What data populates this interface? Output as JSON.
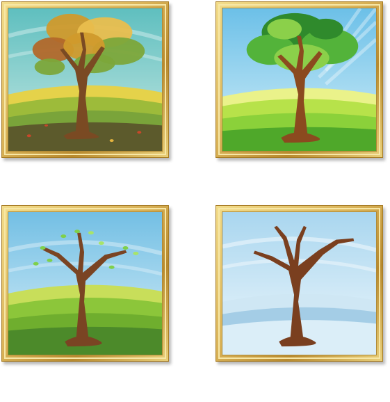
{
  "gallery": {
    "paintings": [
      {
        "season": "autumn",
        "sky": [
          "#5fbfbf",
          "#bfe6e3"
        ],
        "ground": [
          "#e5d24a",
          "#7aa43a",
          "#5c5a2c"
        ],
        "leaf_colors": [
          "#d09a2c",
          "#e9be4e",
          "#7ca63a",
          "#b2682a"
        ]
      },
      {
        "season": "summer",
        "sky": [
          "#6cc0e8",
          "#d2eef8"
        ],
        "ground": [
          "#eaf28a",
          "#8bd13a",
          "#4fa82a"
        ],
        "leaf_colors": [
          "#2f8a2c",
          "#53b33a",
          "#8bd04a"
        ]
      },
      {
        "season": "spring",
        "sky": [
          "#73bfe4",
          "#d6eef8"
        ],
        "ground": [
          "#c8de5a",
          "#6fae2e",
          "#4c8a2a"
        ],
        "leaf_colors": [
          "#7fd04a",
          "#a8e46a"
        ]
      },
      {
        "season": "winter",
        "sky": [
          "#a9d6ef",
          "#eef7fc"
        ],
        "ground": [
          "#cfe7f4",
          "#a4cde6",
          "#dbeef8"
        ],
        "leaf_colors": []
      }
    ]
  }
}
